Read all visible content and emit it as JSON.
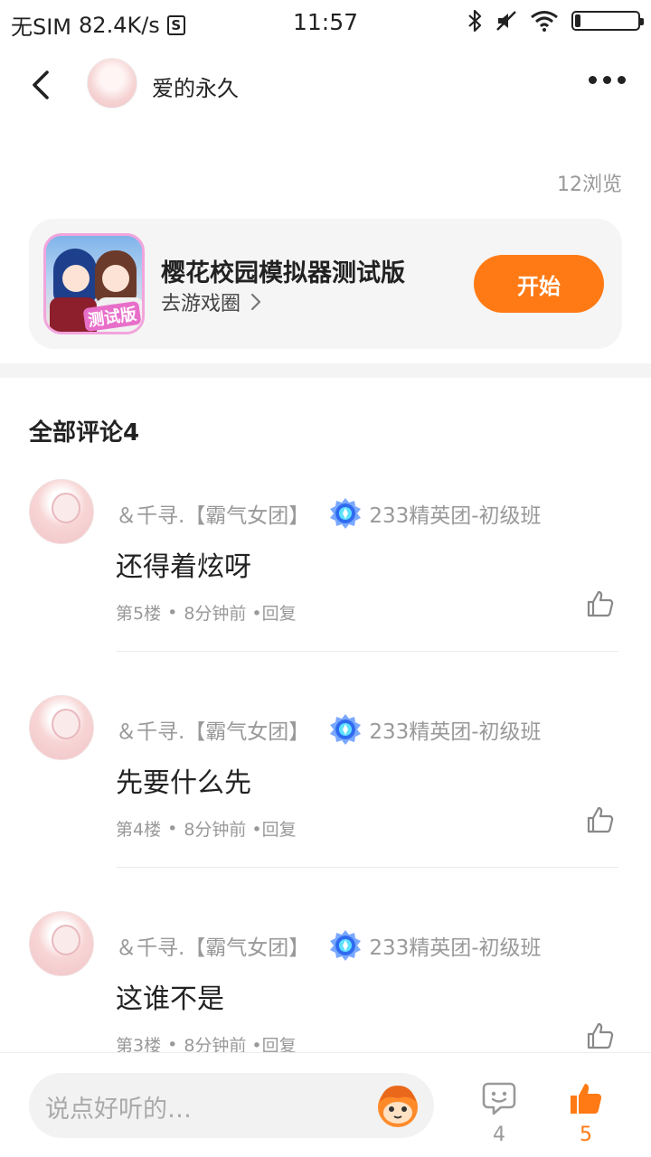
{
  "status_bar": {
    "carrier": "无SIM",
    "speed": "82.4K/s",
    "s_badge": "S",
    "time": "11:57"
  },
  "header": {
    "username": "爱的永久"
  },
  "post": {
    "views": "12浏览"
  },
  "game_card": {
    "title": "樱花校园模拟器测试版",
    "subtitle": "去游戏圈",
    "icon_badge": "测试版",
    "start_label": "开始"
  },
  "comments_section": {
    "heading": "全部评论4"
  },
  "comments": [
    {
      "user": "＆千寻.【霸气女团】",
      "medal": "233精英团-初级班",
      "text": "还得着炫呀",
      "floor": "第5楼",
      "sep": "•",
      "time": "8分钟前",
      "reply": "•回复"
    },
    {
      "user": "＆千寻.【霸气女团】",
      "medal": "233精英团-初级班",
      "text": "先要什么先",
      "floor": "第4楼",
      "sep": "•",
      "time": "8分钟前",
      "reply": "•回复"
    },
    {
      "user": "＆千寻.【霸气女团】",
      "medal": "233精英团-初级班",
      "text": "这谁不是",
      "floor": "第3楼",
      "sep": "•",
      "time": "8分钟前",
      "reply": "•回复"
    }
  ],
  "bottom_bar": {
    "input_placeholder": "说点好听的…",
    "comment_count": "4",
    "like_count": "5"
  },
  "colors": {
    "accent": "#ff7a14",
    "muted_text": "#999999",
    "card_bg": "#f5f5f5"
  },
  "icons": {
    "back": "chevron-left-icon",
    "more": "more-dots-icon",
    "subtitle_arrow": "chevron-right-icon",
    "medal": "medal-icon",
    "like": "thumbs-up-icon",
    "comment": "comment-bubble-icon",
    "emoji": "emoji-face-icon"
  }
}
